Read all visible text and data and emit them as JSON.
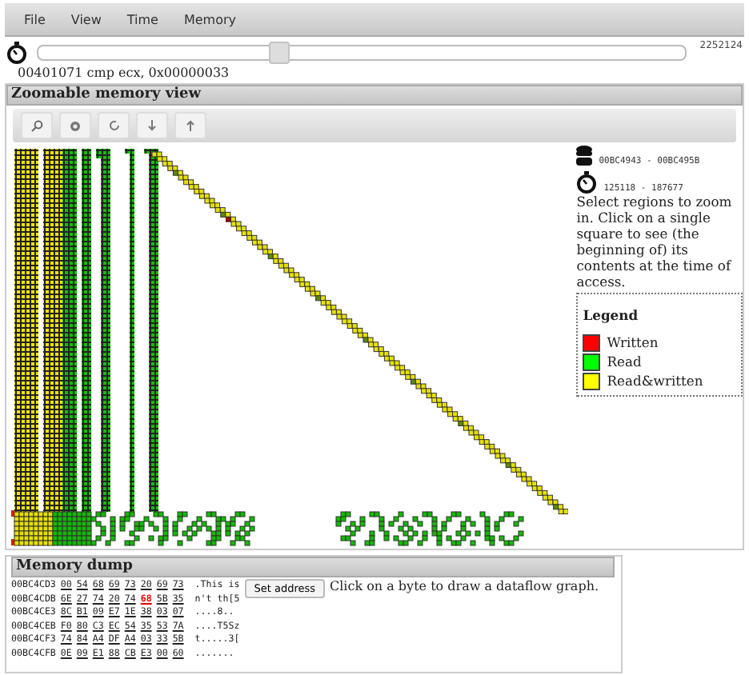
{
  "menu": [
    "File",
    "View",
    "Time",
    "Memory"
  ],
  "timeline": {
    "level": 0.37,
    "max_label": "2252124"
  },
  "instruction": "00401071 cmp ecx, 0x00000033",
  "memory_view": {
    "title": "Zoomable memory view",
    "toolbar": [
      {
        "kind": "search"
      },
      {
        "kind": "gear"
      },
      {
        "kind": "refresh"
      },
      {
        "kind": "down"
      },
      {
        "kind": "up"
      }
    ],
    "address_range": "00BC4943 - 00BC495B",
    "time_range": "125118 - 187677",
    "help": "Select regions to zoom in. Click on a single square to see (the beginning of) its contents at the time of access.",
    "legend": {
      "title": "Legend",
      "items": [
        {
          "label": "Written",
          "color": "#ff0000"
        },
        {
          "label": "Read",
          "color": "#00ff00"
        },
        {
          "label": "Read&written",
          "color": "#ffff00"
        }
      ]
    }
  },
  "memory_dump": {
    "title": "Memory dump",
    "button": "Set address",
    "hint": "Click on a byte to draw a dataflow graph.",
    "rows": [
      {
        "address": "00BC4CD3",
        "bytes": [
          {
            "value": "00",
            "selected": false
          },
          {
            "value": "54",
            "selected": false
          },
          {
            "value": "68",
            "selected": false
          },
          {
            "value": "69",
            "selected": false
          },
          {
            "value": "73",
            "selected": false
          },
          {
            "value": "20",
            "selected": false
          },
          {
            "value": "69",
            "selected": false
          },
          {
            "value": "73",
            "selected": false
          }
        ],
        "ascii": ".This is"
      },
      {
        "address": "00BC4CDB",
        "bytes": [
          {
            "value": "6E",
            "selected": false
          },
          {
            "value": "27",
            "selected": false
          },
          {
            "value": "74",
            "selected": false
          },
          {
            "value": "20",
            "selected": false
          },
          {
            "value": "74",
            "selected": false
          },
          {
            "value": "68",
            "selected": true
          },
          {
            "value": "5B",
            "selected": false
          },
          {
            "value": "35",
            "selected": false
          }
        ],
        "ascii": "n't th[5"
      },
      {
        "address": "00BC4CE3",
        "bytes": [
          {
            "value": "8C",
            "selected": false
          },
          {
            "value": "B1",
            "selected": false
          },
          {
            "value": "09",
            "selected": false
          },
          {
            "value": "E7",
            "selected": false
          },
          {
            "value": "1E",
            "selected": false
          },
          {
            "value": "38",
            "selected": false
          },
          {
            "value": "03",
            "selected": false
          },
          {
            "value": "07",
            "selected": false
          }
        ],
        "ascii": "....8.."
      },
      {
        "address": "00BC4CEB",
        "bytes": [
          {
            "value": "F0",
            "selected": false
          },
          {
            "value": "80",
            "selected": false
          },
          {
            "value": "C3",
            "selected": false
          },
          {
            "value": "EC",
            "selected": false
          },
          {
            "value": "54",
            "selected": false
          },
          {
            "value": "35",
            "selected": false
          },
          {
            "value": "53",
            "selected": false
          },
          {
            "value": "7A",
            "selected": false
          }
        ],
        "ascii": "....T5Sz"
      },
      {
        "address": "00BC4CF3",
        "bytes": [
          {
            "value": "74",
            "selected": false
          },
          {
            "value": "84",
            "selected": false
          },
          {
            "value": "A4",
            "selected": false
          },
          {
            "value": "DF",
            "selected": false
          },
          {
            "value": "A4",
            "selected": false
          },
          {
            "value": "03",
            "selected": false
          },
          {
            "value": "33",
            "selected": false
          },
          {
            "value": "5B",
            "selected": false
          }
        ],
        "ascii": "t.....3["
      },
      {
        "address": "00BC4CFB",
        "bytes": [
          {
            "value": "0E",
            "selected": false
          },
          {
            "value": "09",
            "selected": false
          },
          {
            "value": "E1",
            "selected": false
          },
          {
            "value": "88",
            "selected": false
          },
          {
            "value": "CB",
            "selected": false
          },
          {
            "value": "E3",
            "selected": false
          },
          {
            "value": "00",
            "selected": false
          },
          {
            "value": "60",
            "selected": false
          }
        ],
        "ascii": "......."
      }
    ]
  }
}
